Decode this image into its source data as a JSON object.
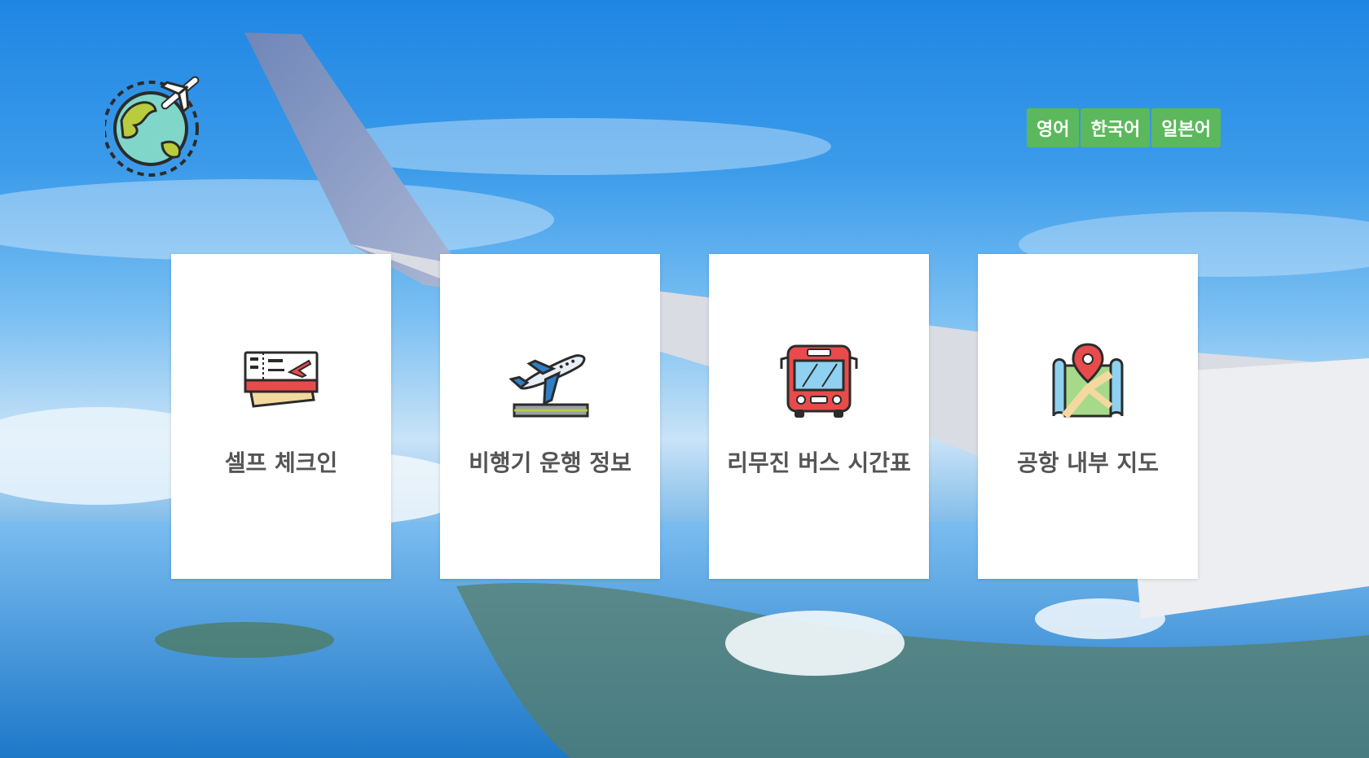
{
  "languages": [
    {
      "label": "영어"
    },
    {
      "label": "한국어"
    },
    {
      "label": "일본어"
    }
  ],
  "menu": [
    {
      "label": "셀프 체크인",
      "icon": "boarding-pass-icon"
    },
    {
      "label": "비행기 운행 정보",
      "icon": "airplane-takeoff-icon"
    },
    {
      "label": "리무진 버스 시간표",
      "icon": "bus-icon"
    },
    {
      "label": "공항 내부 지도",
      "icon": "map-pin-icon"
    }
  ],
  "colors": {
    "lang_button": "#5cb85c",
    "card_bg": "#ffffff",
    "card_text": "#555555"
  }
}
